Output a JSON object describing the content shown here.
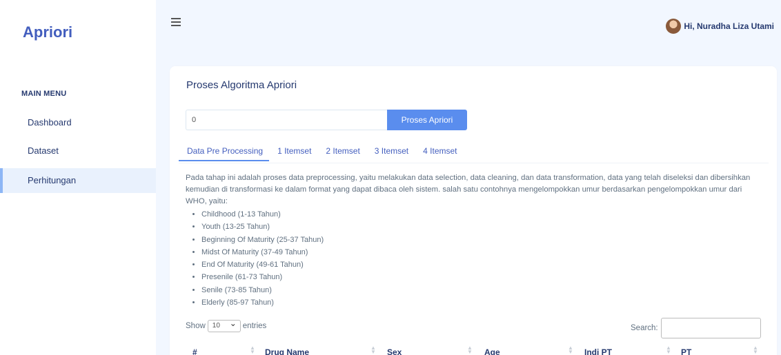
{
  "sidebar": {
    "brand": "Apriori",
    "menu_title": "MAIN MENU",
    "items": [
      {
        "label": "Dashboard"
      },
      {
        "label": "Dataset"
      },
      {
        "label": "Perhitungan"
      }
    ]
  },
  "topbar": {
    "greeting": "Hi, Nuradha Liza Utami"
  },
  "card": {
    "title": "Proses Algoritma Apriori",
    "input_value": "0",
    "button_label": "Proses Apriori",
    "tabs": [
      {
        "label": "Data Pre Processing"
      },
      {
        "label": "1 Itemset"
      },
      {
        "label": "2 Itemset"
      },
      {
        "label": "3 Itemset"
      },
      {
        "label": "4 Itemset"
      }
    ],
    "description": "Pada tahap ini adalah proses data preprocessing, yaitu melakukan data selection, data cleaning, dan data transformation, data yang telah diseleksi dan dibersihkan kemudian di transformasi ke dalam format yang dapat dibaca oleh sistem. salah satu contohnya mengelompokkan umur berdasarkan pengelompokkan umur dari WHO, yaitu:",
    "age_groups": [
      "Childhood (1-13 Tahun)",
      "Youth (13-25 Tahun)",
      "Beginning Of Maturity (25-37 Tahun)",
      "Midst Of Maturity (37-49 Tahun)",
      "End Of Maturity (49-61 Tahun)",
      "Presenile (61-73 Tahun)",
      "Senile (73-85 Tahun)",
      "Elderly (85-97 Tahun)"
    ]
  },
  "table": {
    "show_label": "Show",
    "entries_value": "10",
    "entries_label": "entries",
    "search_label": "Search:",
    "columns": [
      "#",
      "Drug Name",
      "Sex",
      "Age",
      "Indi PT",
      "PT"
    ]
  },
  "icons": {
    "menu": "hamburger-icon",
    "sort": "sort-icon"
  },
  "colors": {
    "brand": "#435ebe",
    "accent": "#5a8dee",
    "active_menu_bg": "#e9f1fd",
    "background": "#f2f7ff"
  }
}
